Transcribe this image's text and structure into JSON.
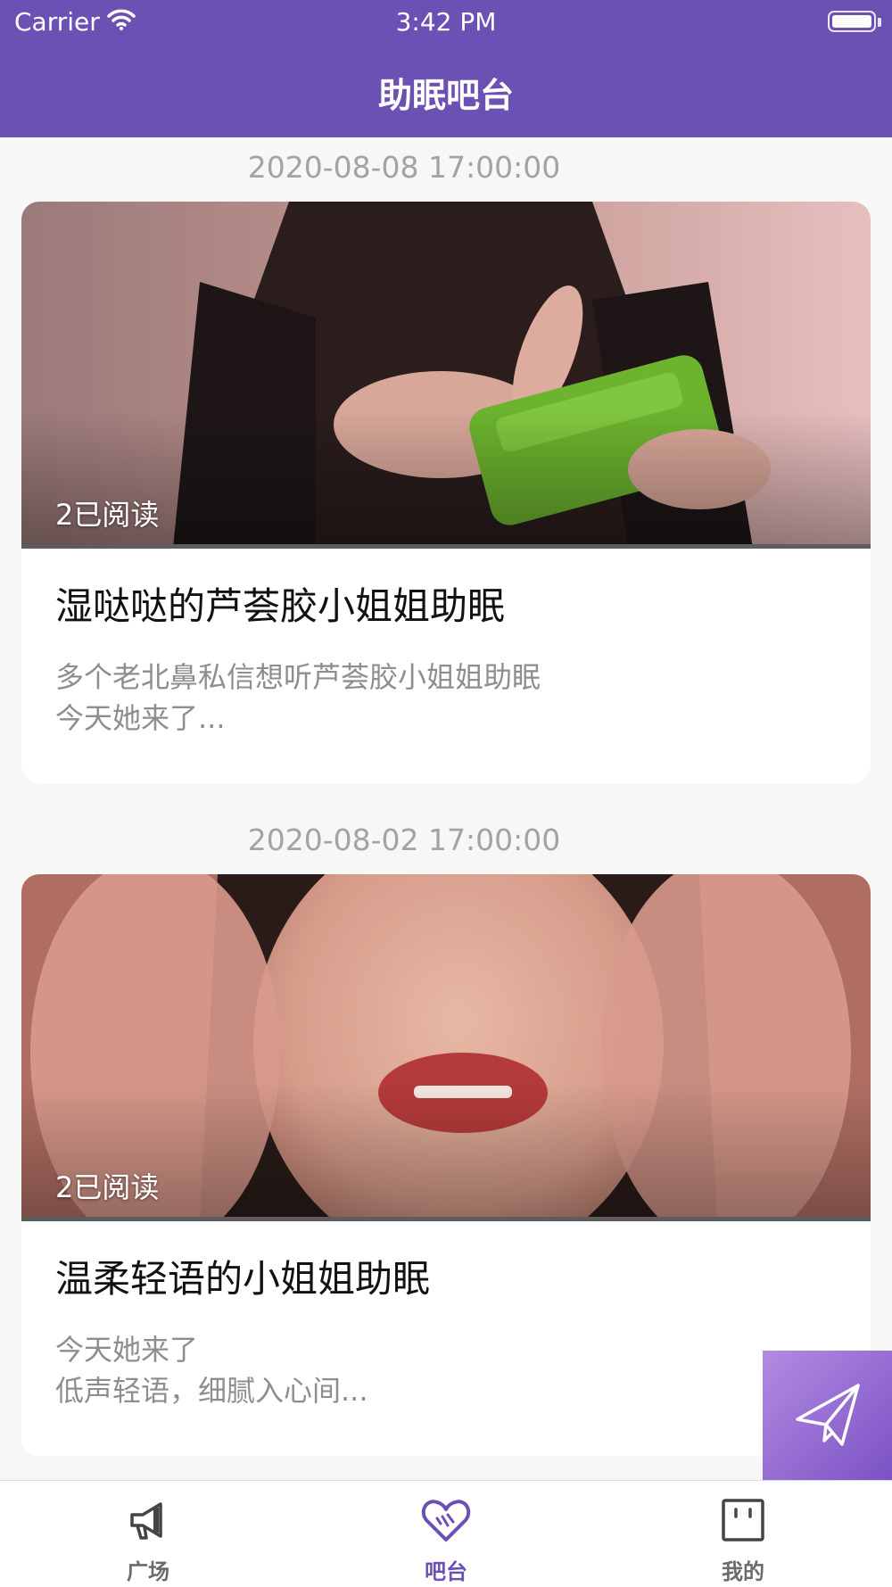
{
  "status_bar": {
    "carrier": "Carrier",
    "time": "3:42 PM"
  },
  "header": {
    "title": "助眠吧台",
    "background": "#6b51b3"
  },
  "posts": [
    {
      "date": "2020-08-08 17:00:00",
      "read_count": "2已阅读",
      "title": "湿哒哒的芦荟胶小姐姐助眠",
      "description": "多个老北鼻私信想听芦荟胶小姐姐助眠\n今天她来了..."
    },
    {
      "date": "2020-08-02 17:00:00",
      "read_count": "2已阅读",
      "title": "温柔轻语的小姐姐助眠",
      "description": "今天她来了\n低声轻语，细腻入心间..."
    }
  ],
  "fab": {
    "icon": "paper-plane-icon"
  },
  "tabbar": {
    "items": [
      {
        "label": "广场",
        "icon": "megaphone-icon"
      },
      {
        "label": "吧台",
        "icon": "heart-icon",
        "active": true
      },
      {
        "label": "我的",
        "icon": "profile-box-icon"
      }
    ],
    "active_color": "#6b51b3"
  }
}
